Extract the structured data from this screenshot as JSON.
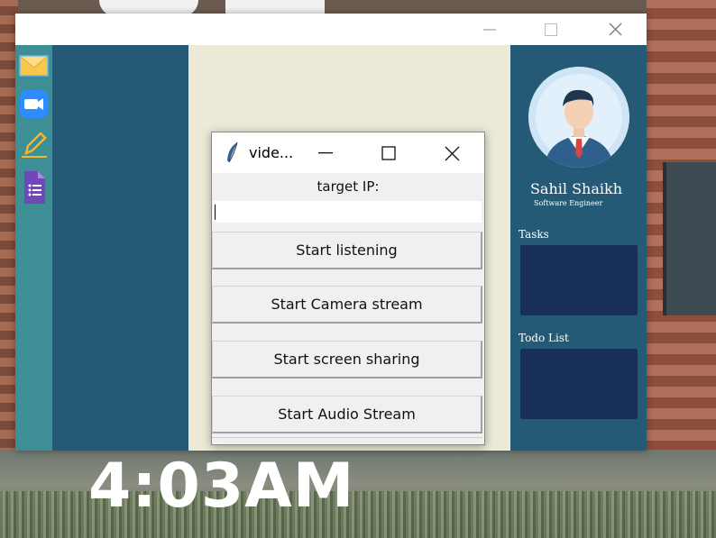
{
  "desktop": {
    "clock": "4:03AM"
  },
  "main_window": {
    "profile": {
      "name": "Sahil Shaikh",
      "role": "Software Engineer"
    },
    "sections": {
      "tasks_label": "Tasks",
      "todo_label": "Todo List"
    },
    "sidebar_icons": [
      "mail-icon",
      "zoom-video-icon",
      "pencil-icon",
      "google-forms-icon"
    ]
  },
  "popup": {
    "title": "vide...",
    "target_label": "target IP:",
    "ip_value": "",
    "buttons": {
      "listen": "Start listening",
      "camera": "Start Camera stream",
      "screen": "Start screen sharing",
      "audio": "Start Audio Stream"
    }
  },
  "colors": {
    "icon_strip": "#3e8e95",
    "panel": "#245a75",
    "content": "#ecead7",
    "section_box": "#182f5a"
  }
}
